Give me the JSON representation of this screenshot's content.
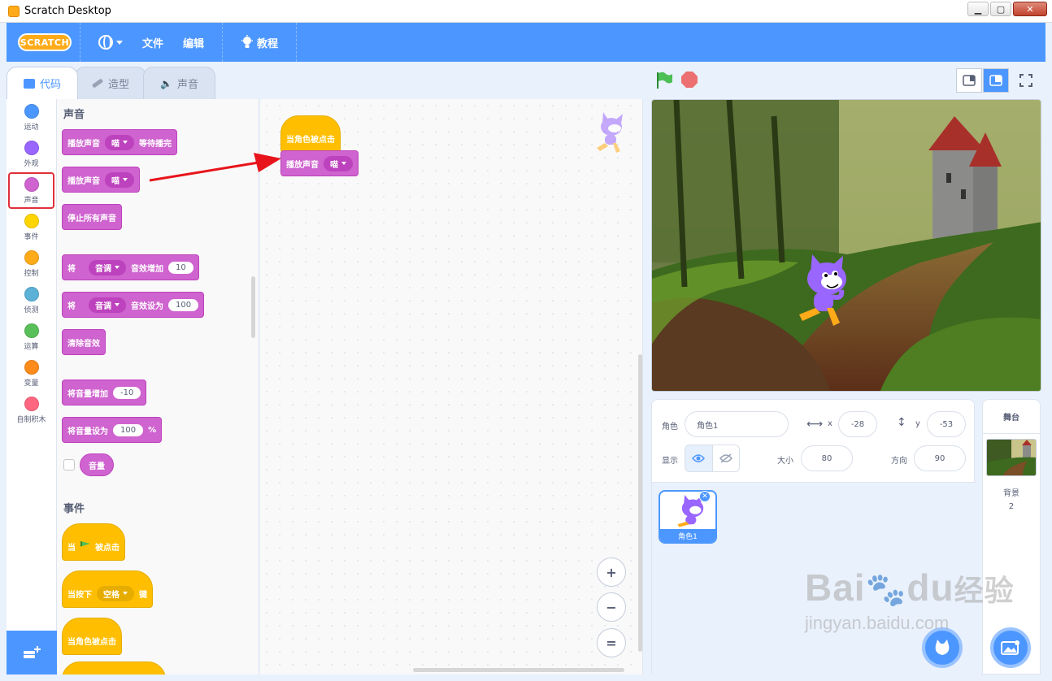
{
  "window": {
    "title": "Scratch Desktop"
  },
  "menubar": {
    "logo": "SCRATCH",
    "file": "文件",
    "edit": "编辑",
    "tutorials": "教程"
  },
  "tabs": [
    {
      "label": "代码"
    },
    {
      "label": "造型"
    },
    {
      "label": "声音"
    }
  ],
  "categories": [
    {
      "label": "运动",
      "color": "#4c97ff"
    },
    {
      "label": "外观",
      "color": "#9966ff"
    },
    {
      "label": "声音",
      "color": "#cf63cf"
    },
    {
      "label": "事件",
      "color": "#ffd500"
    },
    {
      "label": "控制",
      "color": "#ffab19"
    },
    {
      "label": "侦测",
      "color": "#5cb1d6"
    },
    {
      "label": "运算",
      "color": "#59c059"
    },
    {
      "label": "变量",
      "color": "#ff8c1a"
    },
    {
      "label": "自制积木",
      "color": "#ff6680"
    }
  ],
  "palette": {
    "sound_title": "声音",
    "play_until_done": {
      "text": "播放声音",
      "sound": "喵",
      "suffix": "等待播完"
    },
    "start_sound": {
      "text": "播放声音",
      "sound": "喵"
    },
    "stop_all": "停止所有声音",
    "change_effect": {
      "prefix": "将",
      "effect": "音调",
      "text": "音效增加",
      "value": "10"
    },
    "set_effect": {
      "prefix": "将",
      "effect": "音调",
      "text": "音效设为",
      "value": "100"
    },
    "clear_effects": "清除音效",
    "change_volume": {
      "text": "将音量增加",
      "value": "-10"
    },
    "set_volume": {
      "text": "将音量设为",
      "value": "100",
      "suffix": "%"
    },
    "volume_reporter": "音量",
    "events_title": "事件",
    "when_flag": {
      "prefix": "当",
      "suffix": "被点击"
    },
    "when_key": {
      "prefix": "当按下",
      "key": "空格",
      "suffix": "键"
    },
    "when_sprite_clicked": "当角色被点击"
  },
  "script": {
    "hat": "当角色被点击",
    "block": {
      "text": "播放声音",
      "sound": "喵"
    }
  },
  "zoom": {
    "in": "+",
    "out": "−",
    "reset": "="
  },
  "sprite_info": {
    "sprite_label": "角色",
    "sprite_name": "角色1",
    "x_label": "x",
    "x_value": "-28",
    "y_label": "y",
    "y_value": "-53",
    "show_label": "显示",
    "size_label": "大小",
    "size_value": "80",
    "direction_label": "方向",
    "direction_value": "90"
  },
  "sprite_list": [
    {
      "name": "角色1"
    }
  ],
  "stage_pane": {
    "title": "舞台",
    "backdrops_label": "背景",
    "backdrops_count": "2"
  },
  "watermark": {
    "brand": "Bai",
    "paw": "du",
    "cn": "经验",
    "url": "jingyan.baidu.com"
  },
  "colors": {
    "accent": "#4c97ff",
    "sound": "#cf63cf",
    "event": "#ffbf00",
    "highlight": "#e0303a"
  }
}
